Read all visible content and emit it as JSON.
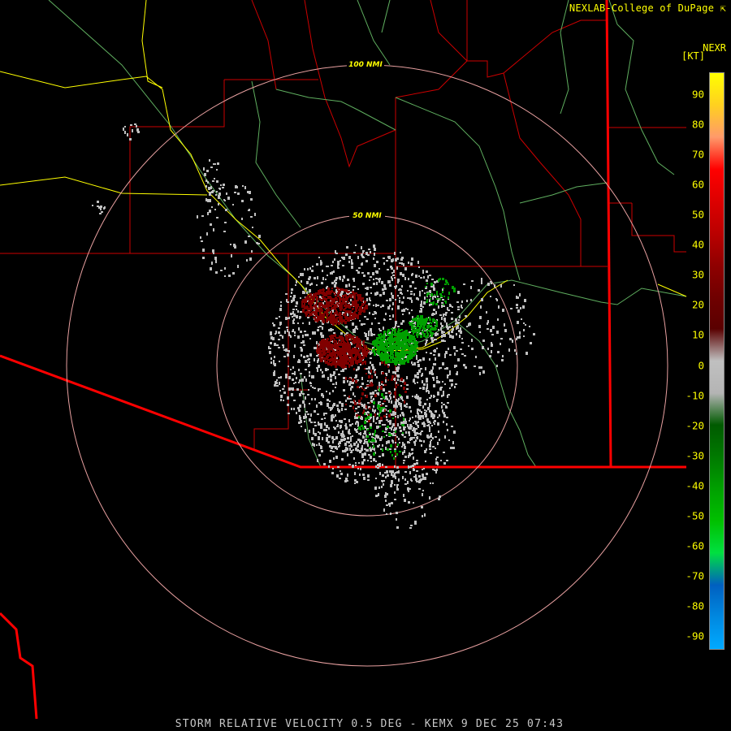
{
  "credit": "NEXLAB-College of DuPage",
  "credit_icon": "cursor-arrow-icon",
  "product": "NEXR",
  "units": "[KT]",
  "footer": "STORM RELATIVE VELOCITY 0.5 DEG - KEMX 9 DEC 25 07:43",
  "range_rings": [
    {
      "label": "100 NMI"
    },
    {
      "label": "50 NMI"
    }
  ],
  "scale": {
    "ticks": [
      "90",
      "80",
      "70",
      "60",
      "50",
      "40",
      "30",
      "20",
      "10",
      "0",
      "-10",
      "-20",
      "-30",
      "-40",
      "-50",
      "-60",
      "-70",
      "-80",
      "-90"
    ],
    "colors": [
      "#ffff00",
      "#ffd020",
      "#ff9a6a",
      "#ff0000",
      "#dd0000",
      "#bb0000",
      "#900000",
      "#700000",
      "#5a0000",
      "#c0c0c0",
      "#b4b4b4",
      "#005a00",
      "#007a00",
      "#00a000",
      "#00c000",
      "#00e040",
      "#0060c0",
      "#0088e0",
      "#00aaff"
    ]
  },
  "colors": {
    "county_lines": "#cc0000",
    "border": "#ff0000",
    "highway": "#ffff00",
    "river": "#5fae5f",
    "rings": "#e8a0a0",
    "noise": "#c0c0c0",
    "outbound": "#800000",
    "inbound": "#00a000"
  }
}
